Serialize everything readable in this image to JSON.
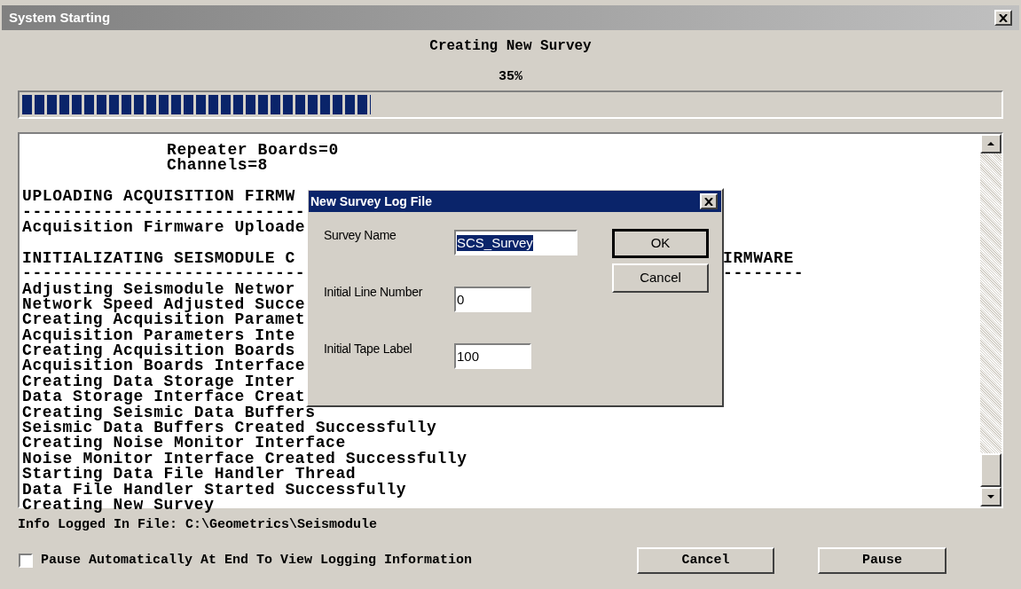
{
  "window": {
    "title": "System Starting"
  },
  "heading": "Creating New Survey",
  "progress": {
    "percent": "35%",
    "level": 0.357
  },
  "log": [
    {
      "kind": "indented",
      "text": "Repeater Boards=0"
    },
    {
      "kind": "indented",
      "text": "Channels=8"
    },
    {
      "kind": "blank"
    },
    {
      "kind": "line",
      "text": "UPLOADING ACQUISITION FIRMW"
    },
    {
      "kind": "line",
      "text": "----------------------------"
    },
    {
      "kind": "line",
      "text": "Acquisition Firmware Uploade"
    },
    {
      "kind": "blank"
    },
    {
      "kind": "line",
      "text": "INITIALIZATING SEISMODULE C",
      "right": "IRMWARE"
    },
    {
      "kind": "line",
      "text": "----------------------------",
      "right": "--------"
    },
    {
      "kind": "line",
      "text": "Adjusting Seismodule Networ"
    },
    {
      "kind": "line",
      "text": "Network Speed Adjusted Succe"
    },
    {
      "kind": "line",
      "text": "Creating Acquisition Paramet"
    },
    {
      "kind": "line",
      "text": "Acquisition Parameters Inte"
    },
    {
      "kind": "line",
      "text": "Creating Acquisition Boards"
    },
    {
      "kind": "line",
      "text": "Acquisition Boards Interface"
    },
    {
      "kind": "line",
      "text": "Creating Data Storage Inter"
    },
    {
      "kind": "line",
      "text": "Data Storage Interface Creat"
    },
    {
      "kind": "line",
      "text": "Creating Seismic Data Buffers"
    },
    {
      "kind": "line",
      "text": "Seismic Data Buffers Created Successfully"
    },
    {
      "kind": "line",
      "text": "Creating Noise Monitor Interface"
    },
    {
      "kind": "line",
      "text": "Noise Monitor Interface Created Successfully"
    },
    {
      "kind": "line",
      "text": "Starting Data File Handler Thread"
    },
    {
      "kind": "line",
      "text": "Data File Handler Started Successfully"
    },
    {
      "kind": "line",
      "text": "Creating New Survey"
    }
  ],
  "info": "Info Logged In File: C:\\Geometrics\\Seismodule",
  "pause_option": {
    "label": "Pause Automatically At End To View Logging Information",
    "checked": false
  },
  "buttons": [
    "Cancel",
    "Pause"
  ],
  "dialog": {
    "title": "New Survey Log File",
    "fields": [
      {
        "label": "Survey Name",
        "value": "SCS_Survey",
        "selected": true
      },
      {
        "label": "Initial Line Number",
        "value": "0",
        "selected": false
      },
      {
        "label": "Initial Tape Label",
        "value": "100",
        "selected": false
      }
    ],
    "buttons": [
      {
        "label": "OK",
        "default": true
      },
      {
        "label": "Cancel",
        "default": false
      }
    ]
  }
}
